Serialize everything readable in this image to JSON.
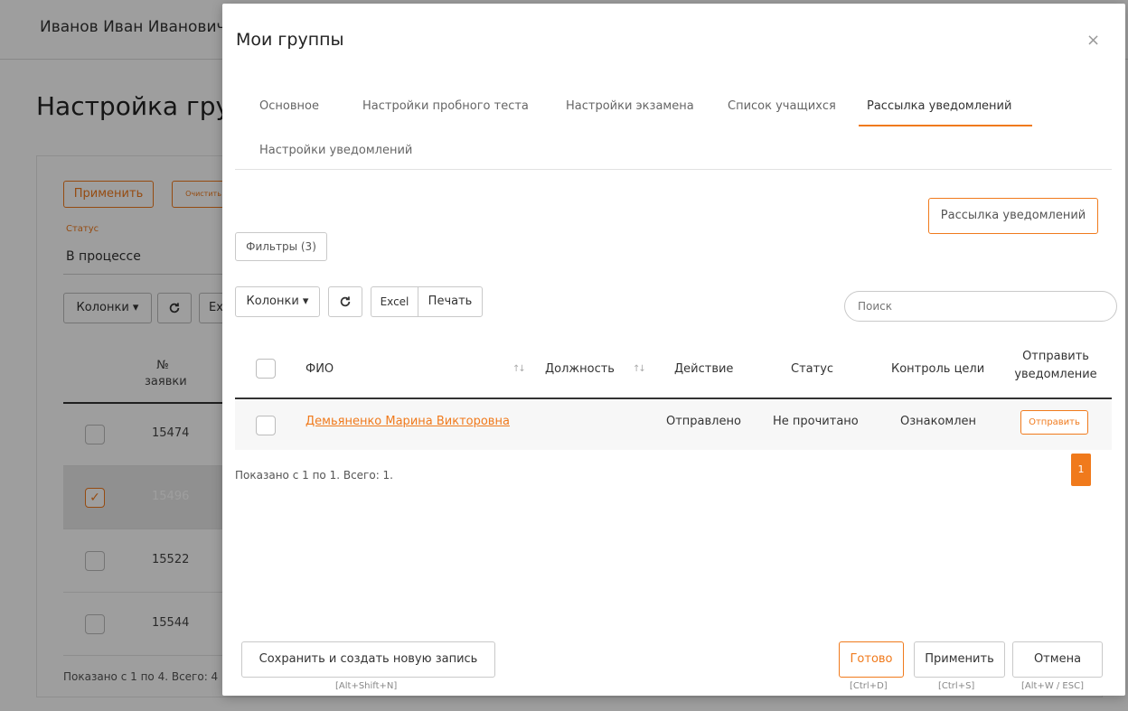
{
  "background": {
    "user_name": "Иванов Иван Иванович",
    "page_title": "Настройка групп",
    "apply_label": "Применить",
    "clear_label": "Очистить",
    "status_label": "Статус",
    "status_value": "В процессе",
    "columns_label": "Колонки ▾",
    "excel_label": "Ex",
    "th_number": "№ заявки",
    "rows": [
      {
        "number": "15474",
        "checked": false
      },
      {
        "number": "15496",
        "checked": true
      },
      {
        "number": "15522",
        "checked": false
      },
      {
        "number": "15544",
        "checked": false
      }
    ],
    "shown_text": "Показано с 1 по 4. Всего: 4"
  },
  "modal": {
    "title": "Мои группы",
    "close_glyph": "×",
    "tabs": [
      {
        "label": "Основное",
        "active": false
      },
      {
        "label": "Настройки пробного теста",
        "active": false
      },
      {
        "label": "Настройки экзамена",
        "active": false
      },
      {
        "label": "Список учащихся",
        "active": false
      },
      {
        "label": "Рассылка уведомлений",
        "active": true
      },
      {
        "label": "Настройки уведомлений",
        "active": false
      }
    ],
    "broadcast_button": "Рассылка уведомлений",
    "filters_button": "Фильтры (3)",
    "toolbar": {
      "columns": "Колонки ▾",
      "refresh_icon": "refresh-icon",
      "excel": "Excel",
      "print": "Печать",
      "search_placeholder": "Поиск"
    },
    "table": {
      "headers": {
        "fio": "ФИО",
        "position": "Должность",
        "action": "Действие",
        "status": "Статус",
        "goal_control": "Контроль цели",
        "send_line1": "Отправить",
        "send_line2": "уведомление"
      },
      "sort_glyph": "↑↓",
      "rows": [
        {
          "fio": "Демьяненко Марина Викторовна",
          "position": "",
          "action": "Отправлено",
          "status": "Не прочитано",
          "goal_control": "Ознакомлен",
          "send_button": "Отправить"
        }
      ]
    },
    "shown_text": "Показано с 1 по 1. Всего: 1.",
    "current_page": "1",
    "footer": {
      "save_new": "Сохранить и создать новую запись",
      "save_new_hint": "[Alt+Shift+N]",
      "done": "Готово",
      "done_hint": "[Ctrl+D]",
      "apply": "Применить",
      "apply_hint": "[Ctrl+S]",
      "cancel": "Отмена",
      "cancel_hint": "[Alt+W / ESC]"
    }
  },
  "colors": {
    "accent": "#f07a1c",
    "overlay": "rgba(0,0,0,0.38)"
  }
}
